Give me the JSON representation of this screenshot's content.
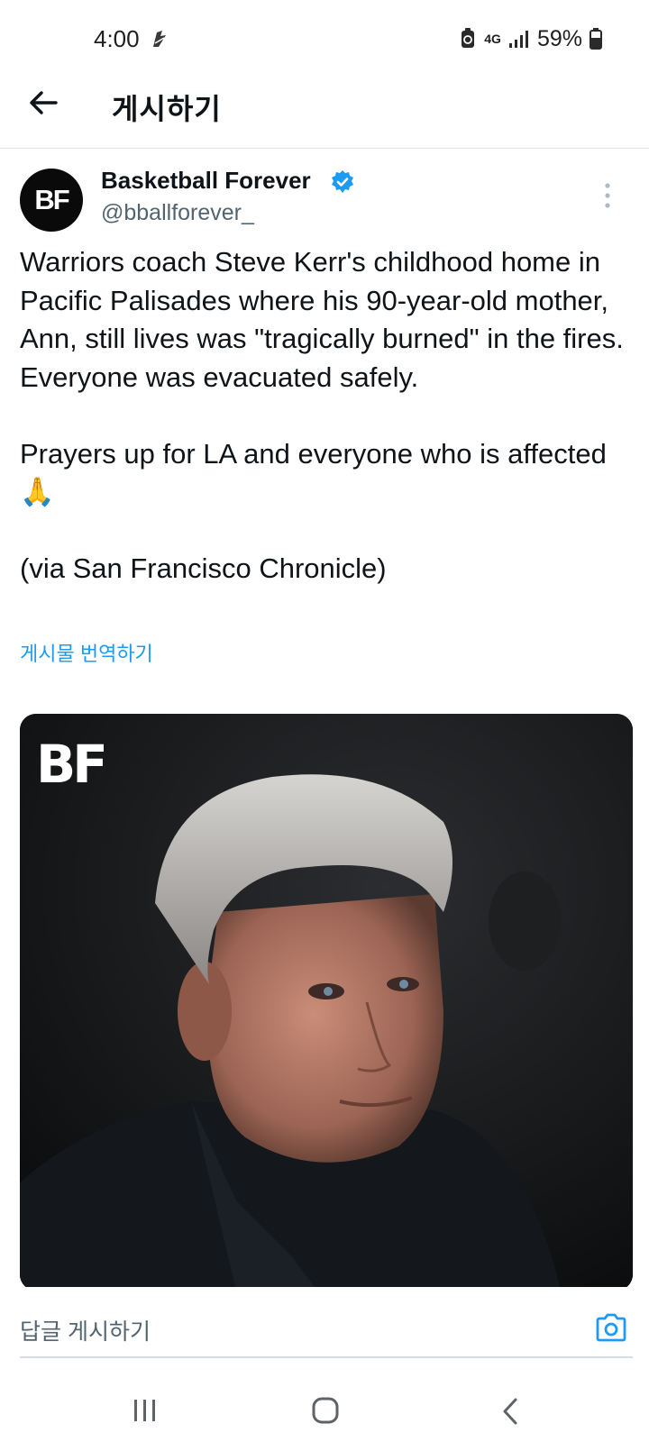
{
  "status_bar": {
    "time": "4:00",
    "network": "4G",
    "battery": "59%"
  },
  "app_bar": {
    "title": "게시하기",
    "back_icon": "arrow-left-icon"
  },
  "post": {
    "author": {
      "avatar_text": "BF",
      "display_name": "Basketball Forever",
      "handle": "@bballforever_",
      "verified": true
    },
    "text_paragraphs": [
      "Warriors coach Steve Kerr's childhood home in Pacific Palisades where his 90-year-old mother, Ann, still lives was \"tragically burned\" in the fires. Everyone was evacuated safely.",
      "Prayers up for LA and everyone who is affected 🙏",
      "(via San Francisco Chronicle)"
    ],
    "translate_link": "게시물 번역하기",
    "media": {
      "logo_text": "BF"
    }
  },
  "reply": {
    "placeholder": "답글 게시하기",
    "camera_icon": "camera-icon"
  },
  "colors": {
    "accent": "#1d9bf0",
    "text": "#0f1419",
    "secondary_text": "#536471"
  }
}
